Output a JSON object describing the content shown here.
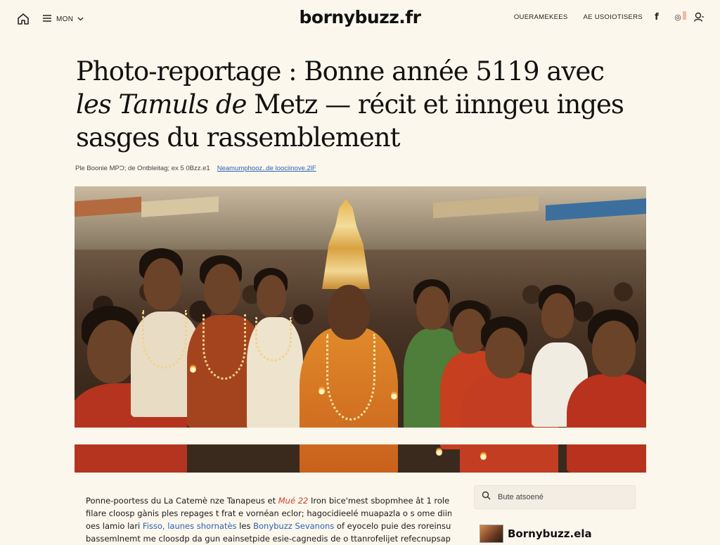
{
  "header": {
    "menu_label": "MON",
    "logo": "bornybuzz.fr",
    "nav": [
      "OUERAMEKEES",
      "AE USOIOTISERS"
    ],
    "icons": {
      "home": "home-icon",
      "menu": "hamburger-icon",
      "dropdown": "chevron-down-icon",
      "facebook": "facebook-icon",
      "instagram": "instagram-icon",
      "account": "user-icon"
    }
  },
  "article": {
    "title_line1": "Photo-reportage : Bonne année 5119 avec",
    "title_line2_italic": "les Tamuls de",
    "title_line2_rest": " Metz — récit et iinngeu inges",
    "title_line3": "sasges du rassemblement",
    "byline_text": "Ple Boonie MPϽ; de Ontbleitag; ex 5 0Bzz.e1",
    "byline_link": "Neamumphooz..de loociinove.2lF",
    "hero_alt": "Photo du rassemblement tamoul",
    "body": [
      {
        "a": "Ponne-poortess du La Catemè nze Tanapeus et ",
        "hl": "Mué 22",
        "b": " Iron bice'mest sbopmhee ât  1 role"
      },
      {
        "a": "filare cloosp gànis ples repages t frat e vornéan eclor; hagocidieelé muapazla  o s  ome diinu nosíés"
      },
      {
        "a": "oes lamio lari ",
        "link1": "Fisso,",
        "b": " ",
        "link2": "launes shornatès",
        "c": " les ",
        "link3": "Bonybuzz Sevanons",
        "d": " of eyocelo puie des roreinsut"
      },
      {
        "a": "bassemlnemt me cloosdp da gun eainsetpide esie-cagnedis de o ttanrofelijet refecnupsaplet et"
      }
    ]
  },
  "sidebar": {
    "search_placeholder": "Bute atsoené",
    "brand_name": "Bornybuzz.ela",
    "icons": {
      "search": "search-icon"
    }
  },
  "colors": {
    "background": "#fcf7ec",
    "link": "#2b63b8",
    "highlight": "#d23c2a"
  }
}
